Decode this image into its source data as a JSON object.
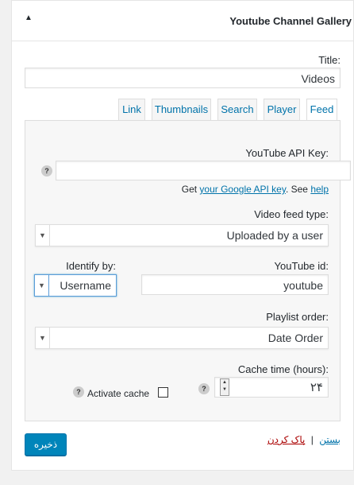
{
  "widget": {
    "title": "Youtube Channel Gallery",
    "toggle_arrow": "▲"
  },
  "title_field": {
    "label": ":Title",
    "value": "Videos"
  },
  "tabs": [
    {
      "label": "Link"
    },
    {
      "label": "Thumbnails"
    },
    {
      "label": "Search"
    },
    {
      "label": "Player"
    },
    {
      "label": "Feed",
      "active": true
    }
  ],
  "feed": {
    "api_key_label": ":YouTube API Key",
    "api_key_value": "",
    "api_help_prefix": "Get",
    "api_help_link": "your Google API key",
    "api_help_middle": ". See",
    "api_help_link2": "help",
    "feed_type_label": ":Video feed type",
    "feed_type_value": "Uploaded by a user",
    "youtube_id_label": ":YouTube id",
    "youtube_id_value": "youtube",
    "identify_by_label": ":Identify by",
    "identify_by_value": "Username",
    "playlist_order_label": ":Playlist order",
    "playlist_order_value": "Date Order",
    "cache_time_label": ":Cache time (hours)",
    "cache_time_value": "۲۴",
    "activate_cache_label": "Activate cache",
    "help_glyph": "?"
  },
  "footer": {
    "delete_label": "پاک کردن",
    "separator": "|",
    "close_label": "بستن",
    "save_label": "ذخیره"
  },
  "colors": {
    "link": "#0073aa",
    "delete": "#a00",
    "primary_button": "#0085ba"
  }
}
